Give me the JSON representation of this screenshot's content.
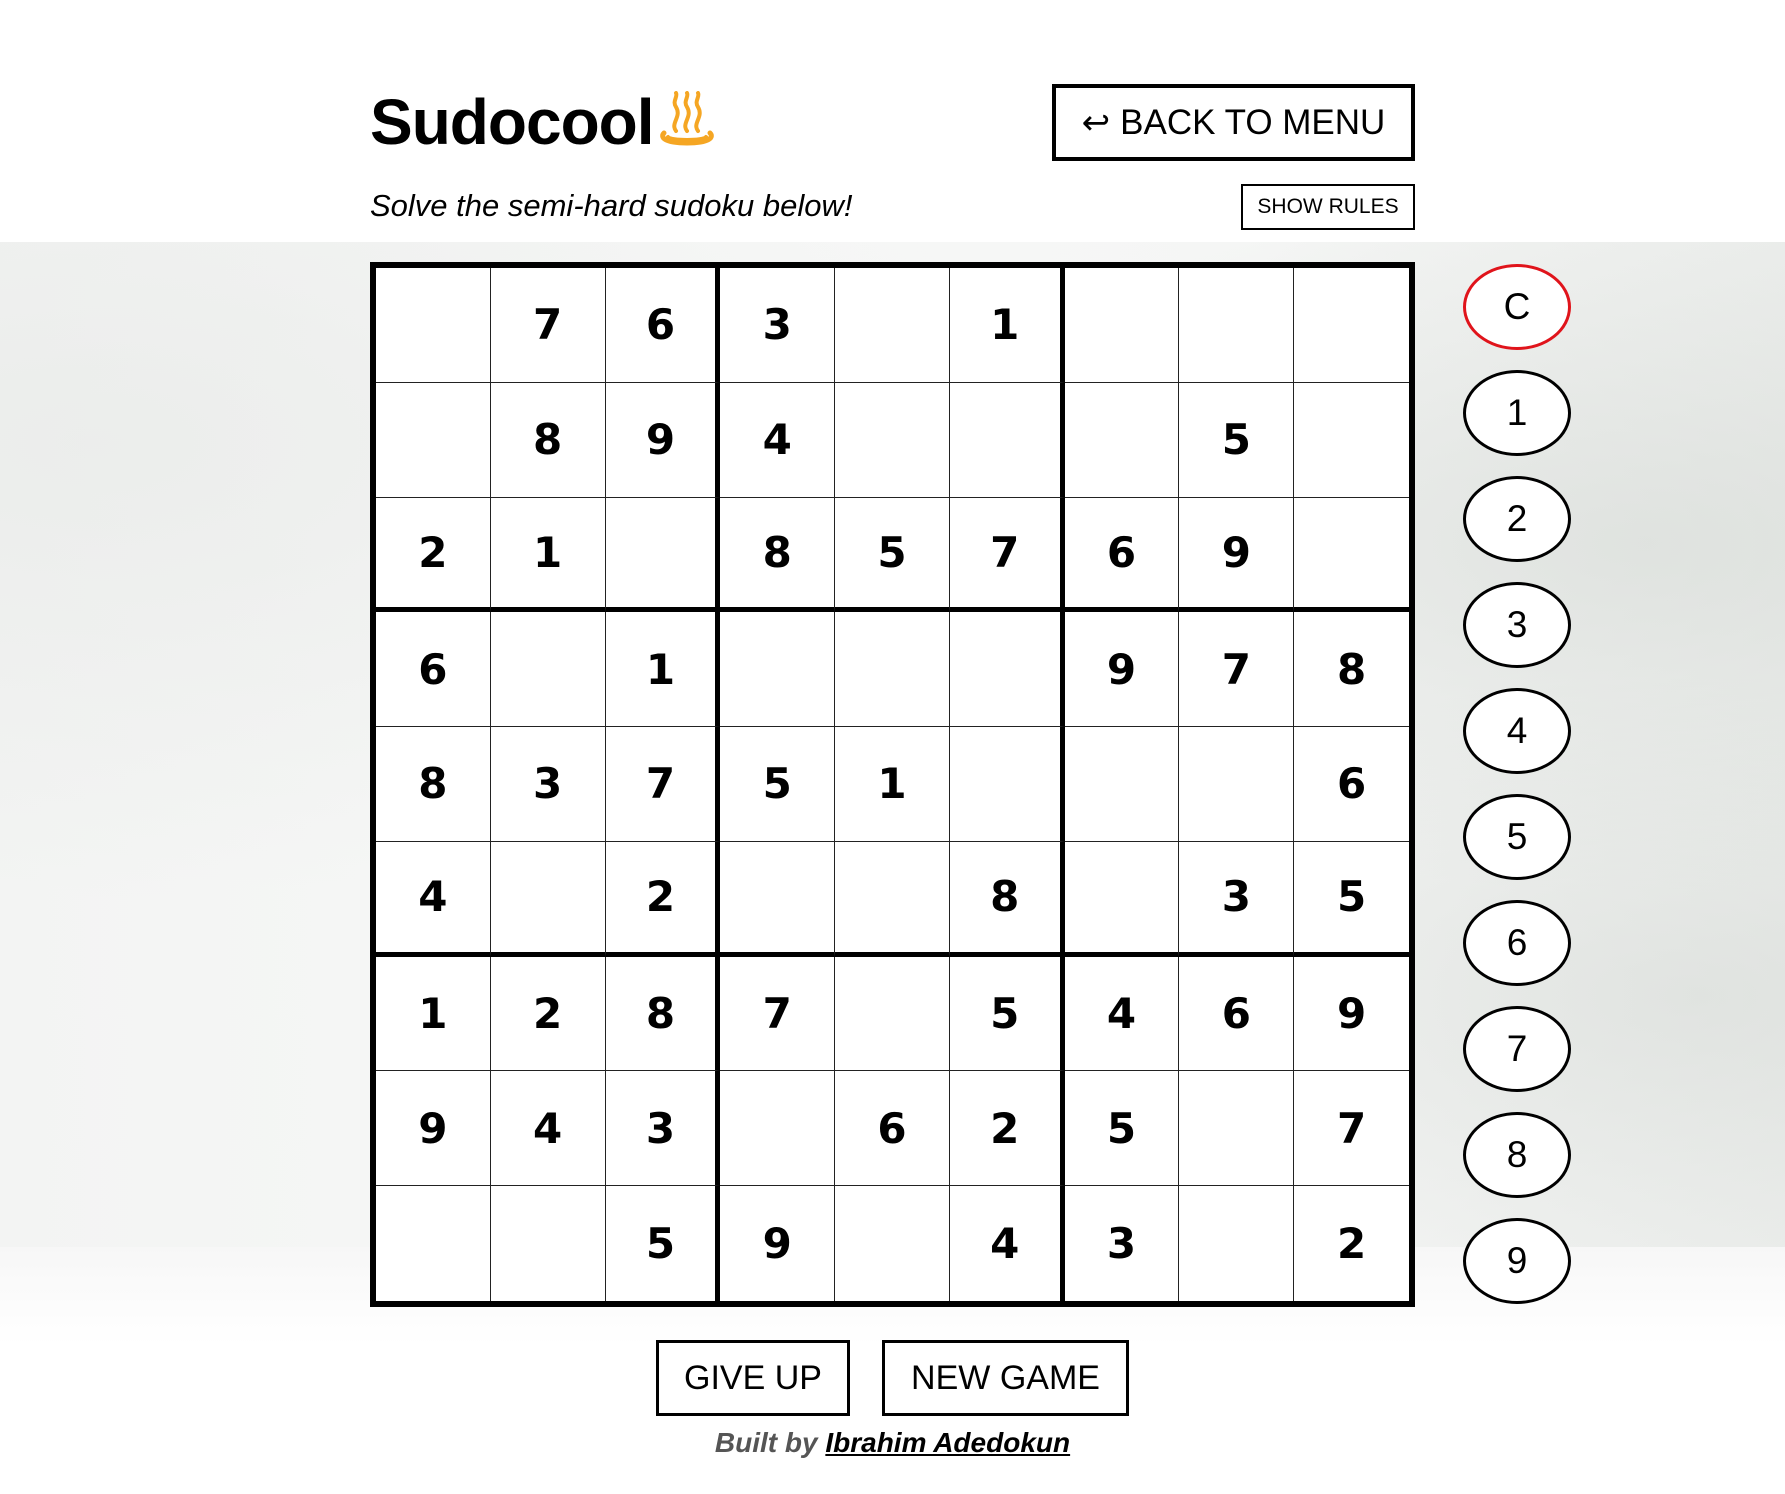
{
  "header": {
    "title": "Sudocool",
    "title_icon": "hot-springs-icon",
    "subtitle": "Solve the semi-hard sudoku below!",
    "back_icon": "return-arrow-icon",
    "back_arrow": "↩",
    "back_label": "BACK TO MENU",
    "rules_label": "SHOW RULES"
  },
  "board": {
    "rows": [
      [
        "",
        "7",
        "6",
        "3",
        "",
        "1",
        "",
        "",
        ""
      ],
      [
        "",
        "8",
        "9",
        "4",
        "",
        "",
        "",
        "5",
        ""
      ],
      [
        "2",
        "1",
        "",
        "8",
        "5",
        "7",
        "6",
        "9",
        ""
      ],
      [
        "6",
        "",
        "1",
        "",
        "",
        "",
        "9",
        "7",
        "8"
      ],
      [
        "8",
        "3",
        "7",
        "5",
        "1",
        "",
        "",
        "",
        "6"
      ],
      [
        "4",
        "",
        "2",
        "",
        "",
        "8",
        "",
        "3",
        "5"
      ],
      [
        "1",
        "2",
        "8",
        "7",
        "",
        "5",
        "4",
        "6",
        "9"
      ],
      [
        "9",
        "4",
        "3",
        "",
        "6",
        "2",
        "5",
        "",
        "7"
      ],
      [
        "",
        "",
        "5",
        "9",
        "",
        "4",
        "3",
        "",
        "2"
      ]
    ]
  },
  "picker": {
    "options": [
      "C",
      "1",
      "2",
      "3",
      "4",
      "5",
      "6",
      "7",
      "8",
      "9"
    ],
    "selected": "C",
    "selected_color": "#e0141b"
  },
  "actions": {
    "give_up_label": "GIVE UP",
    "new_game_label": "NEW GAME"
  },
  "footer": {
    "built_by": "Built by",
    "author": "Ibrahim Adedokun"
  }
}
